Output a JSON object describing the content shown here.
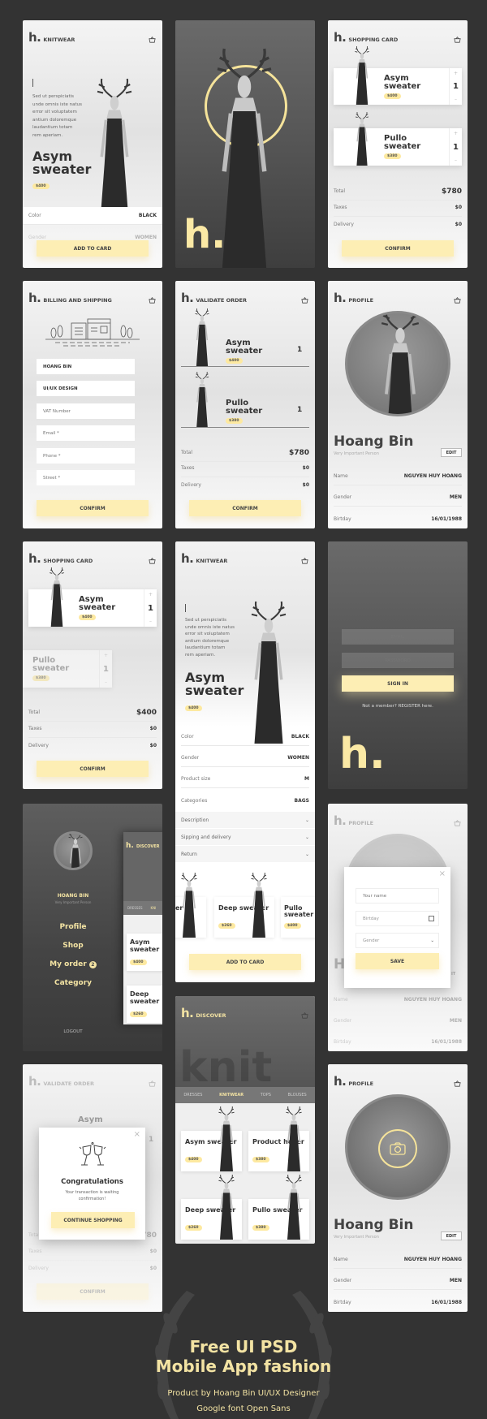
{
  "brand": "h.",
  "colors": {
    "background": "#333333",
    "accent": "#fdeeb4",
    "accent_text": "#f3e3a3",
    "ring": "#f5e39a"
  },
  "icons": {
    "cart": "cart-icon",
    "chevron": "chevron-down-icon",
    "close": "close-icon",
    "calendar": "calendar-icon",
    "camera": "camera-icon",
    "cheers": "cheers-icon"
  },
  "knitwear": {
    "title": "KNITWEAR",
    "description": "Sed ut perspiciatis unde omnis iste natus error sit voluptatem antium doloremque laudantium totam rem aperiam.",
    "product": "Asym sweater",
    "price": "$400",
    "rows": [
      {
        "label": "Color",
        "value": "BLACK"
      },
      {
        "label": "Gender",
        "value": "WOMEN"
      }
    ],
    "button": "ADD TO CARD"
  },
  "splash": {
    "logo": "h."
  },
  "cart": {
    "title": "SHOPPING CARD",
    "items": [
      {
        "name": "Asym sweater",
        "price": "$400",
        "qty": "1"
      },
      {
        "name": "Pullo sweater",
        "price": "$380",
        "qty": "1"
      }
    ],
    "summary": [
      {
        "label": "Total",
        "value": "$780"
      },
      {
        "label": "Taxes",
        "value": "$0"
      },
      {
        "label": "Delivery",
        "value": "$0"
      }
    ],
    "button": "CONFIRM"
  },
  "billing": {
    "title": "BILLING AND SHIPPING",
    "fields": [
      {
        "value": "HOANG BIN",
        "placeholder": ""
      },
      {
        "value": "UI/UX DESIGN",
        "placeholder": ""
      },
      {
        "value": "",
        "placeholder": "VAT Number"
      },
      {
        "value": "",
        "placeholder": "Email *"
      },
      {
        "value": "",
        "placeholder": "Phone *"
      },
      {
        "value": "",
        "placeholder": "Street *"
      }
    ],
    "button": "CONFIRM"
  },
  "validate": {
    "title": "VALIDATE ORDER",
    "items": [
      {
        "name": "Asym sweater",
        "price": "$400",
        "qty": "1"
      },
      {
        "name": "Pullo sweater",
        "price": "$380",
        "qty": "1"
      }
    ],
    "summary": [
      {
        "label": "Total",
        "value": "$780"
      },
      {
        "label": "Taxes",
        "value": "$0"
      },
      {
        "label": "Delivery",
        "value": "$0"
      }
    ],
    "button": "CONFIRM"
  },
  "profile": {
    "title": "PROFILE",
    "name": "Hoang Bin",
    "role": "Very Important Person",
    "edit": "EDIT",
    "rows": [
      {
        "label": "Name",
        "value": "NGUYEN HUY HOANG"
      },
      {
        "label": "Gender",
        "value": "MEN"
      },
      {
        "label": "Birtday",
        "value": "16/01/1988"
      }
    ]
  },
  "cart2": {
    "title": "SHOPPING CARD",
    "items": [
      {
        "name": "Asym sweater",
        "price": "$400",
        "qty": "1"
      },
      {
        "name": "Pullo sweater",
        "price": "$380",
        "qty": "1"
      }
    ],
    "summary": [
      {
        "label": "Total",
        "value": "$400"
      },
      {
        "label": "Taxes",
        "value": "$0"
      },
      {
        "label": "Delivery",
        "value": "$0"
      }
    ],
    "button": "CONFIRM"
  },
  "knitwear_detail": {
    "title": "KNITWEAR",
    "description": "Sed ut perspiciatis unde omnis iste natus error sit voluptatem antium doloremque laudantium totam rem aperiam.",
    "product": "Asym sweater",
    "price": "$400",
    "rows": [
      {
        "label": "Color",
        "value": "BLACK"
      },
      {
        "label": "Gender",
        "value": "WOMEN"
      },
      {
        "label": "Product size",
        "value": "M"
      },
      {
        "label": "Categories",
        "value": "BAGS"
      }
    ],
    "accordions": [
      "Description",
      "Sipping and delivery",
      "Return"
    ],
    "related": [
      {
        "name": "er",
        "price": ""
      },
      {
        "name": "Deep sweater",
        "price": "$260"
      },
      {
        "name": "Pullo sweater",
        "price": "$400"
      }
    ],
    "button": "ADD TO CARD"
  },
  "login": {
    "email_placeholder": "EMAIL",
    "password_placeholder": "PASSWORD",
    "signin": "SIGN IN",
    "register": "Not a member? REGISTER here.",
    "logo": "h."
  },
  "menu": {
    "name": "HOANG BIN",
    "role": "Very Important Person",
    "items": [
      "Profile",
      "Shop",
      "My order",
      "Category"
    ],
    "order_badge": "2",
    "logout": "LOGOUT",
    "peek": {
      "title": "DISCOVER",
      "tabs": [
        "DRESSES",
        "KNI"
      ],
      "items": [
        {
          "name": "Asym sweater",
          "price": "$400"
        },
        {
          "name": "Deep sweater",
          "price": "$260"
        }
      ]
    }
  },
  "profile_edit": {
    "title": "PROFILE",
    "name_initial": "H",
    "edit_partial": "IT",
    "fields": {
      "name_placeholder": "Your name",
      "birthday_placeholder": "Birtday",
      "gender_placeholder": "Gender"
    },
    "save": "SAVE"
  },
  "discover": {
    "title": "DISCOVER",
    "hero_text": "knit",
    "tabs": [
      "DRESSES",
      "KNITWEAR",
      "TOPS",
      "BLOUSES"
    ],
    "active_tab": "KNITWEAR",
    "items": [
      {
        "name": "Asym sweater",
        "price": "$400"
      },
      {
        "name": "Product hover",
        "price": "$380"
      },
      {
        "name": "Deep sweater",
        "price": "$260"
      },
      {
        "name": "Pullo sweater",
        "price": "$380"
      }
    ]
  },
  "congrats": {
    "background_item": "Asym",
    "heading": "Congratulations",
    "message": "Your transaction is waiting confirmation!",
    "button": "CONTINUE SHOPPING"
  },
  "footer": {
    "title_line1": "Free UI PSD",
    "title_line2": "Mobile App fashion",
    "credit": "Product by Hoang Bin UI/UX Designer",
    "font_note": "Google font Open Sans"
  }
}
